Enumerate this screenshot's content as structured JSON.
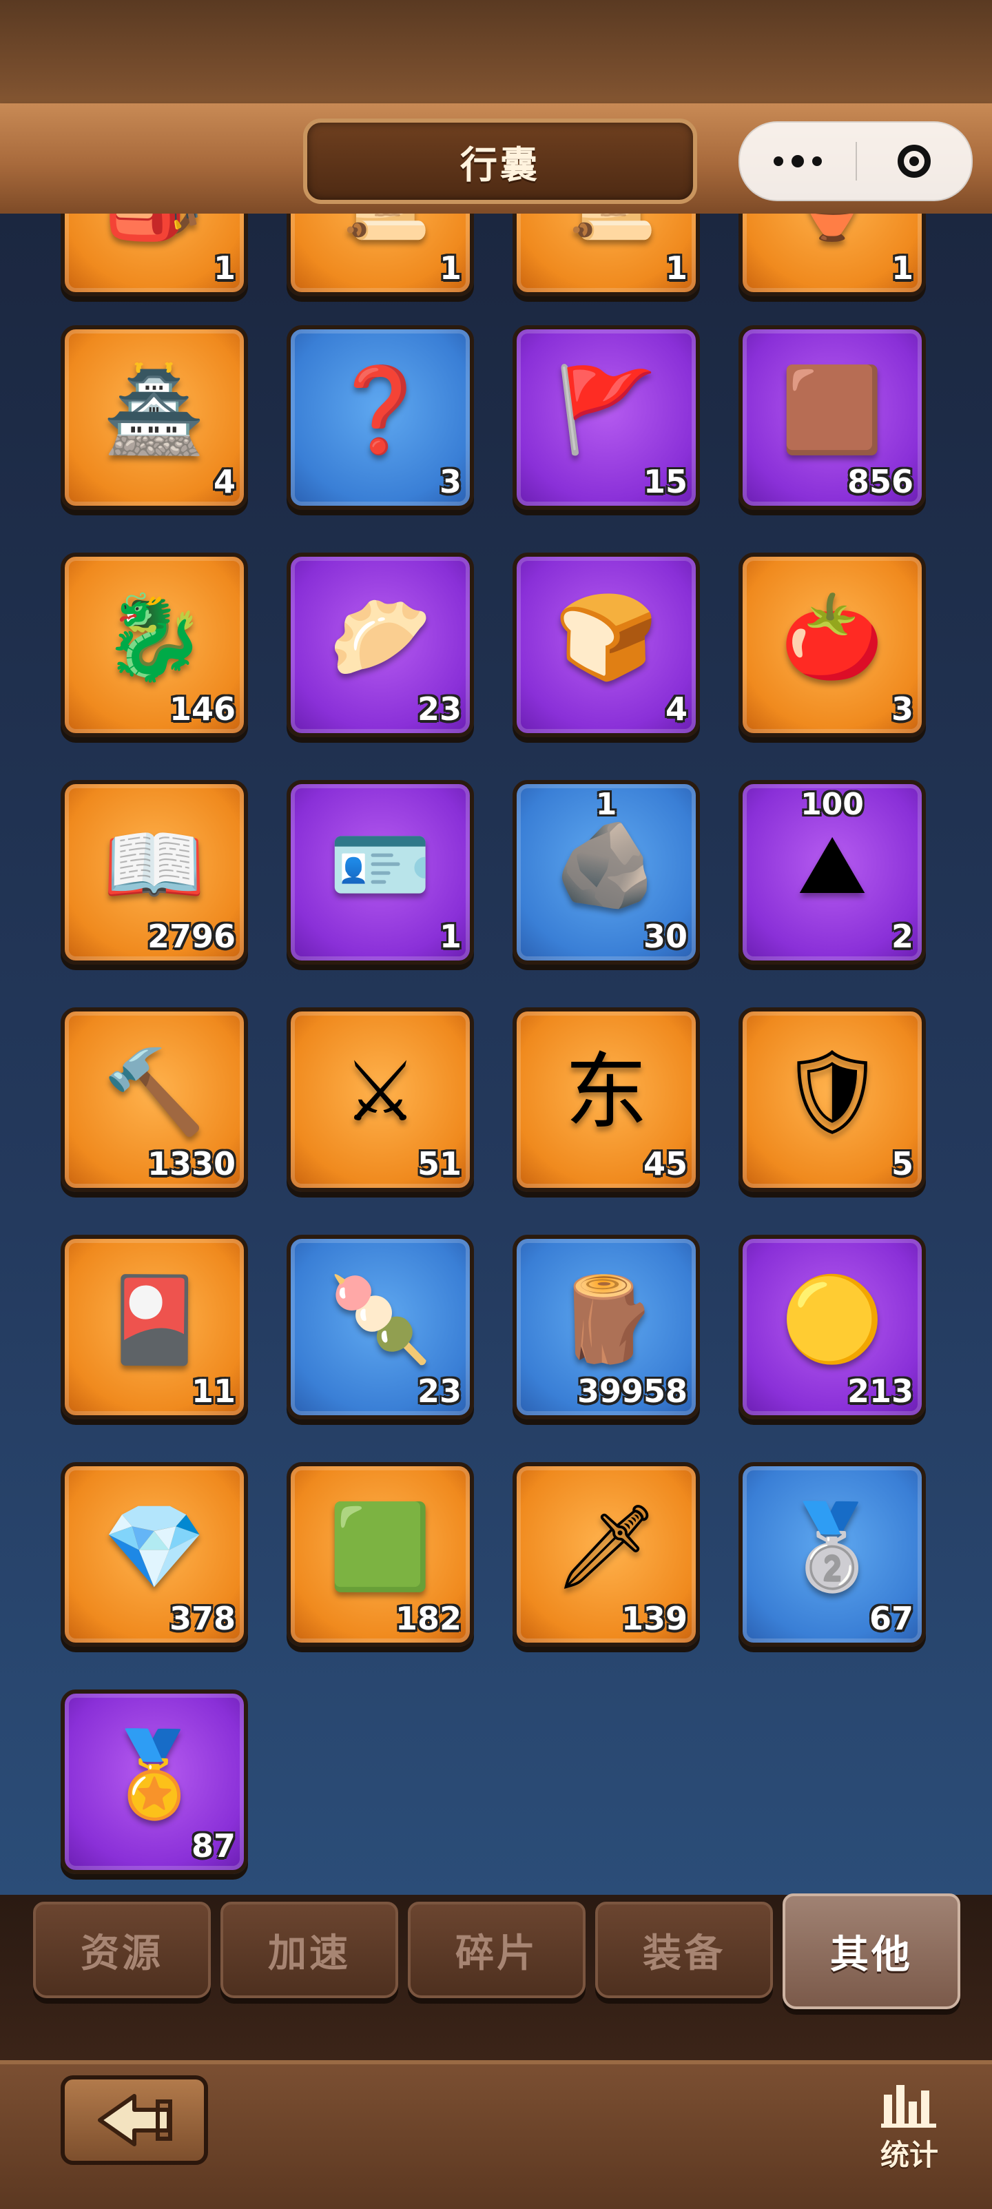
{
  "header": {
    "title": "行囊"
  },
  "tabs": [
    {
      "label": "资源"
    },
    {
      "label": "加速"
    },
    {
      "label": "碎片"
    },
    {
      "label": "装备"
    },
    {
      "label": "其他",
      "active": true
    }
  ],
  "footer": {
    "stats_label": "统计"
  },
  "items_cut": [
    {
      "icon": "green-bag-icon",
      "count": "1",
      "rarity": "orange",
      "glyph": "🎒"
    },
    {
      "icon": "scroll-icon",
      "count": "1",
      "rarity": "orange",
      "glyph": "📜"
    },
    {
      "icon": "scroll-icon",
      "count": "1",
      "rarity": "orange",
      "glyph": "📜"
    },
    {
      "icon": "lamp-icon",
      "count": "1",
      "rarity": "orange",
      "glyph": "🏺"
    }
  ],
  "items": [
    {
      "icon": "fortress-relocate-icon",
      "count": "4",
      "rarity": "orange",
      "glyph": "🏯"
    },
    {
      "icon": "random-relocate-icon",
      "count": "3",
      "rarity": "blue",
      "glyph": "❓"
    },
    {
      "icon": "banner-relocate-icon",
      "count": "15",
      "rarity": "purple",
      "glyph": "🚩"
    },
    {
      "icon": "leather-icon",
      "count": "856",
      "rarity": "purple",
      "glyph": "🟫"
    },
    {
      "icon": "dragon-coin-icon",
      "count": "146",
      "rarity": "orange",
      "glyph": "🐉"
    },
    {
      "icon": "bun-icon",
      "count": "23",
      "rarity": "purple",
      "glyph": "🥟"
    },
    {
      "icon": "pastry-icon",
      "count": "4",
      "rarity": "purple",
      "glyph": "🍞"
    },
    {
      "icon": "persimmon-icon",
      "count": "3",
      "rarity": "orange",
      "glyph": "🍅"
    },
    {
      "icon": "book-scroll-icon",
      "count": "2796",
      "rarity": "orange",
      "glyph": "📖"
    },
    {
      "icon": "green-card-icon",
      "count": "1",
      "rarity": "purple",
      "glyph": "🪪"
    },
    {
      "icon": "stone-icon",
      "count": "30",
      "top": "1",
      "rarity": "blue",
      "glyph": "🪨"
    },
    {
      "icon": "ore-pile-icon",
      "count": "2",
      "top": "100",
      "rarity": "purple",
      "glyph": "⛰"
    },
    {
      "icon": "hammer-crystal-icon",
      "count": "1330",
      "rarity": "orange",
      "glyph": "🔨"
    },
    {
      "icon": "crossed-swords-puzzle-icon",
      "count": "51",
      "rarity": "orange",
      "glyph": "⚔"
    },
    {
      "icon": "east-token-icon",
      "count": "45",
      "rarity": "orange",
      "glyph": "东"
    },
    {
      "icon": "red-shield-icon",
      "count": "5",
      "rarity": "orange",
      "glyph": "🛡"
    },
    {
      "icon": "chariot-card-icon",
      "count": "11",
      "rarity": "orange",
      "glyph": "🎴"
    },
    {
      "icon": "dumplings-icon",
      "count": "23",
      "rarity": "blue",
      "glyph": "🍡"
    },
    {
      "icon": "log-icon",
      "count": "39958",
      "rarity": "blue",
      "glyph": "🪵"
    },
    {
      "icon": "gold-ore-icon",
      "count": "213",
      "rarity": "purple",
      "glyph": "🟡"
    },
    {
      "icon": "sapphire-icon",
      "count": "378",
      "rarity": "orange",
      "glyph": "💎"
    },
    {
      "icon": "jade-icon",
      "count": "182",
      "rarity": "orange",
      "glyph": "🟩"
    },
    {
      "icon": "dagger-icon",
      "count": "139",
      "rarity": "orange",
      "glyph": "🗡"
    },
    {
      "icon": "silver-medal-icon",
      "count": "67",
      "rarity": "blue",
      "glyph": "🥈"
    },
    {
      "icon": "red-medal-icon",
      "count": "87",
      "rarity": "purple",
      "glyph": "🏅"
    }
  ]
}
